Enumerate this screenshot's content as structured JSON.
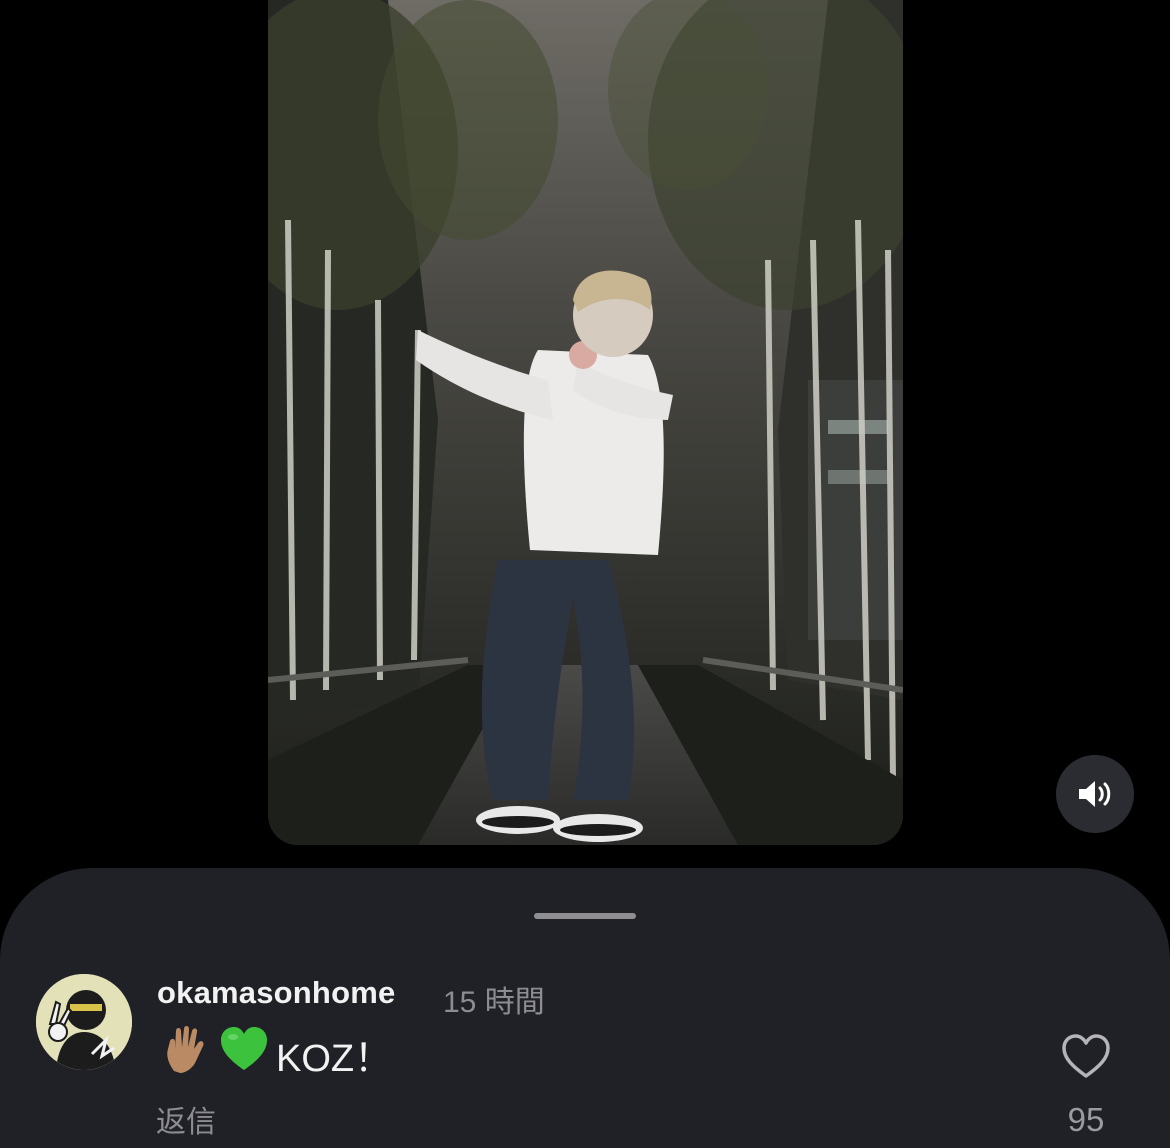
{
  "video": {
    "volume_icon": "speaker-on-icon"
  },
  "comment": {
    "username": "okamasonhome",
    "timestamp": "15 時間",
    "emoji_1": "vulcan-salute-emoji",
    "emoji_2": "green-heart-emoji",
    "text": "KOZ！",
    "reply_label": "返信",
    "like_count": "95",
    "like_icon": "heart-outline-icon"
  },
  "colors": {
    "background": "#000000",
    "sheet": "#202126",
    "primary_text": "#f2f2f2",
    "secondary_text": "#8c8c92",
    "green_heart": "#3cc23c"
  }
}
